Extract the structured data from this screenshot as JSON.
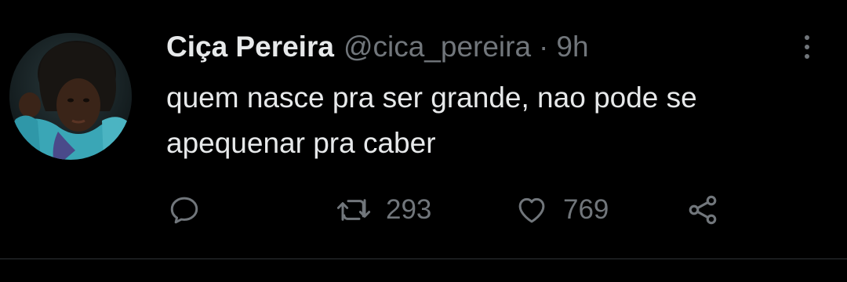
{
  "tweet": {
    "author_name": "Ciça Pereira",
    "handle": "@cica_pereira",
    "separator": "·",
    "time": "9h",
    "text_line_1": "quem nasce pra ser grande, nao pode se",
    "text_line_2": "apequenar pra caber"
  },
  "actions": {
    "reply": {
      "icon": "reply-icon"
    },
    "retweet": {
      "icon": "retweet-icon",
      "count": "293"
    },
    "like": {
      "icon": "heart-icon",
      "count": "769"
    },
    "share": {
      "icon": "share-icon"
    }
  },
  "colors": {
    "background": "#000000",
    "primary_text": "#e7e9ea",
    "secondary_text": "#71767b",
    "divider": "#2f3336"
  }
}
